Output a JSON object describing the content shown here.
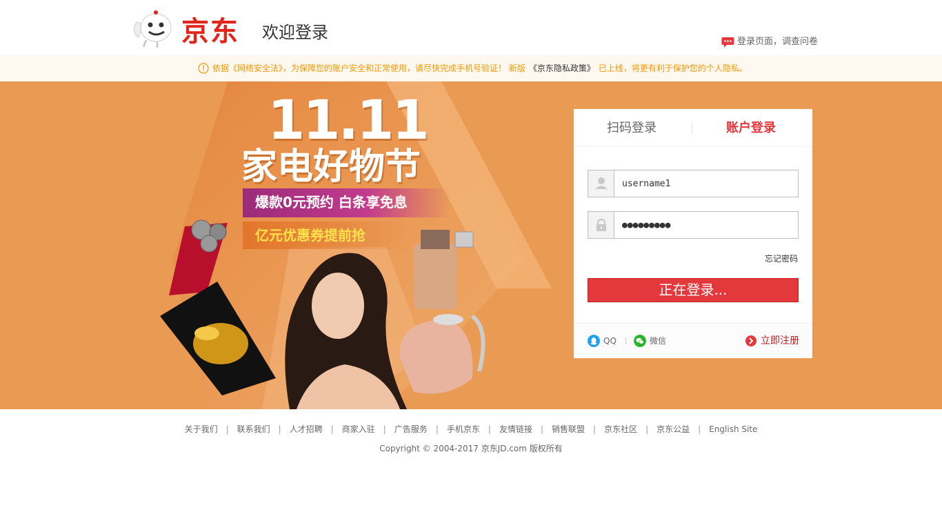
{
  "header": {
    "brand": "京东",
    "welcome": "欢迎登录",
    "feedback_label": "登录页面，调查问卷"
  },
  "notice": {
    "text_before": "依据《网络安全法》，为保障您的账户安全和正常使用，请尽快完成手机号验证！ 新版",
    "policy_link": "《京东隐私政策》",
    "text_after": "已上线，将更有利于保护您的个人隐私。"
  },
  "promo": {
    "number": "11.11",
    "title": "家电好物节",
    "line1": "爆款0元预约 白条享免息",
    "line2": "亿元优惠券提前抢"
  },
  "login": {
    "tabs": [
      {
        "label": "扫码登录",
        "active": false
      },
      {
        "label": "账户登录",
        "active": true
      }
    ],
    "username_value": "username1",
    "password_value": "●●●●●●●●●",
    "forgot_label": "忘记密码",
    "submit_label": "正在登录...",
    "qq_label": "QQ",
    "wechat_label": "微信",
    "register_label": "立即注册"
  },
  "footer": {
    "links": [
      "关于我们",
      "联系我们",
      "人才招聘",
      "商家入驻",
      "广告服务",
      "手机京东",
      "友情链接",
      "销售联盟",
      "京东社区",
      "京东公益",
      "English Site"
    ],
    "separator": "|",
    "copyright": "Copyright © 2004-2017  京东JD.com 版权所有"
  },
  "colors": {
    "brand_red": "#e4393c",
    "banner_orange": "#e99b54",
    "notice_orange": "#f39800"
  }
}
